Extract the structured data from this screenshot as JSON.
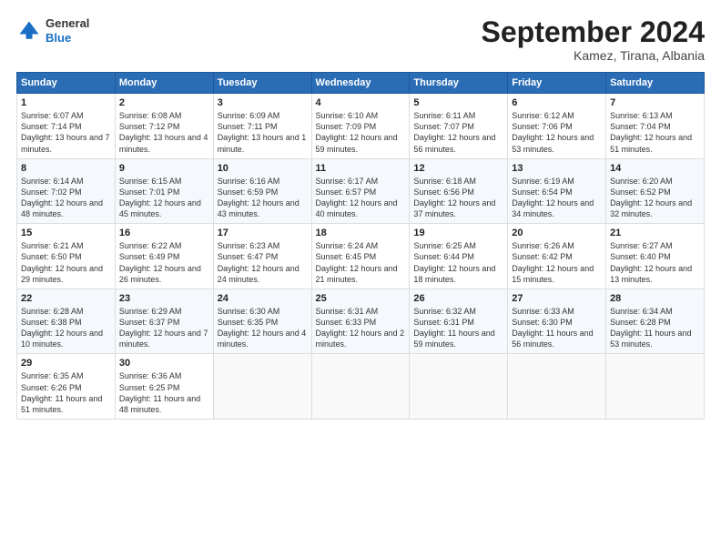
{
  "header": {
    "logo_line1": "General",
    "logo_line2": "Blue",
    "month": "September 2024",
    "location": "Kamez, Tirana, Albania"
  },
  "columns": [
    "Sunday",
    "Monday",
    "Tuesday",
    "Wednesday",
    "Thursday",
    "Friday",
    "Saturday"
  ],
  "weeks": [
    [
      {
        "day": "1",
        "sunrise": "Sunrise: 6:07 AM",
        "sunset": "Sunset: 7:14 PM",
        "daylight": "Daylight: 13 hours and 7 minutes."
      },
      {
        "day": "2",
        "sunrise": "Sunrise: 6:08 AM",
        "sunset": "Sunset: 7:12 PM",
        "daylight": "Daylight: 13 hours and 4 minutes."
      },
      {
        "day": "3",
        "sunrise": "Sunrise: 6:09 AM",
        "sunset": "Sunset: 7:11 PM",
        "daylight": "Daylight: 13 hours and 1 minute."
      },
      {
        "day": "4",
        "sunrise": "Sunrise: 6:10 AM",
        "sunset": "Sunset: 7:09 PM",
        "daylight": "Daylight: 12 hours and 59 minutes."
      },
      {
        "day": "5",
        "sunrise": "Sunrise: 6:11 AM",
        "sunset": "Sunset: 7:07 PM",
        "daylight": "Daylight: 12 hours and 56 minutes."
      },
      {
        "day": "6",
        "sunrise": "Sunrise: 6:12 AM",
        "sunset": "Sunset: 7:06 PM",
        "daylight": "Daylight: 12 hours and 53 minutes."
      },
      {
        "day": "7",
        "sunrise": "Sunrise: 6:13 AM",
        "sunset": "Sunset: 7:04 PM",
        "daylight": "Daylight: 12 hours and 51 minutes."
      }
    ],
    [
      {
        "day": "8",
        "sunrise": "Sunrise: 6:14 AM",
        "sunset": "Sunset: 7:02 PM",
        "daylight": "Daylight: 12 hours and 48 minutes."
      },
      {
        "day": "9",
        "sunrise": "Sunrise: 6:15 AM",
        "sunset": "Sunset: 7:01 PM",
        "daylight": "Daylight: 12 hours and 45 minutes."
      },
      {
        "day": "10",
        "sunrise": "Sunrise: 6:16 AM",
        "sunset": "Sunset: 6:59 PM",
        "daylight": "Daylight: 12 hours and 43 minutes."
      },
      {
        "day": "11",
        "sunrise": "Sunrise: 6:17 AM",
        "sunset": "Sunset: 6:57 PM",
        "daylight": "Daylight: 12 hours and 40 minutes."
      },
      {
        "day": "12",
        "sunrise": "Sunrise: 6:18 AM",
        "sunset": "Sunset: 6:56 PM",
        "daylight": "Daylight: 12 hours and 37 minutes."
      },
      {
        "day": "13",
        "sunrise": "Sunrise: 6:19 AM",
        "sunset": "Sunset: 6:54 PM",
        "daylight": "Daylight: 12 hours and 34 minutes."
      },
      {
        "day": "14",
        "sunrise": "Sunrise: 6:20 AM",
        "sunset": "Sunset: 6:52 PM",
        "daylight": "Daylight: 12 hours and 32 minutes."
      }
    ],
    [
      {
        "day": "15",
        "sunrise": "Sunrise: 6:21 AM",
        "sunset": "Sunset: 6:50 PM",
        "daylight": "Daylight: 12 hours and 29 minutes."
      },
      {
        "day": "16",
        "sunrise": "Sunrise: 6:22 AM",
        "sunset": "Sunset: 6:49 PM",
        "daylight": "Daylight: 12 hours and 26 minutes."
      },
      {
        "day": "17",
        "sunrise": "Sunrise: 6:23 AM",
        "sunset": "Sunset: 6:47 PM",
        "daylight": "Daylight: 12 hours and 24 minutes."
      },
      {
        "day": "18",
        "sunrise": "Sunrise: 6:24 AM",
        "sunset": "Sunset: 6:45 PM",
        "daylight": "Daylight: 12 hours and 21 minutes."
      },
      {
        "day": "19",
        "sunrise": "Sunrise: 6:25 AM",
        "sunset": "Sunset: 6:44 PM",
        "daylight": "Daylight: 12 hours and 18 minutes."
      },
      {
        "day": "20",
        "sunrise": "Sunrise: 6:26 AM",
        "sunset": "Sunset: 6:42 PM",
        "daylight": "Daylight: 12 hours and 15 minutes."
      },
      {
        "day": "21",
        "sunrise": "Sunrise: 6:27 AM",
        "sunset": "Sunset: 6:40 PM",
        "daylight": "Daylight: 12 hours and 13 minutes."
      }
    ],
    [
      {
        "day": "22",
        "sunrise": "Sunrise: 6:28 AM",
        "sunset": "Sunset: 6:38 PM",
        "daylight": "Daylight: 12 hours and 10 minutes."
      },
      {
        "day": "23",
        "sunrise": "Sunrise: 6:29 AM",
        "sunset": "Sunset: 6:37 PM",
        "daylight": "Daylight: 12 hours and 7 minutes."
      },
      {
        "day": "24",
        "sunrise": "Sunrise: 6:30 AM",
        "sunset": "Sunset: 6:35 PM",
        "daylight": "Daylight: 12 hours and 4 minutes."
      },
      {
        "day": "25",
        "sunrise": "Sunrise: 6:31 AM",
        "sunset": "Sunset: 6:33 PM",
        "daylight": "Daylight: 12 hours and 2 minutes."
      },
      {
        "day": "26",
        "sunrise": "Sunrise: 6:32 AM",
        "sunset": "Sunset: 6:31 PM",
        "daylight": "Daylight: 11 hours and 59 minutes."
      },
      {
        "day": "27",
        "sunrise": "Sunrise: 6:33 AM",
        "sunset": "Sunset: 6:30 PM",
        "daylight": "Daylight: 11 hours and 56 minutes."
      },
      {
        "day": "28",
        "sunrise": "Sunrise: 6:34 AM",
        "sunset": "Sunset: 6:28 PM",
        "daylight": "Daylight: 11 hours and 53 minutes."
      }
    ],
    [
      {
        "day": "29",
        "sunrise": "Sunrise: 6:35 AM",
        "sunset": "Sunset: 6:26 PM",
        "daylight": "Daylight: 11 hours and 51 minutes."
      },
      {
        "day": "30",
        "sunrise": "Sunrise: 6:36 AM",
        "sunset": "Sunset: 6:25 PM",
        "daylight": "Daylight: 11 hours and 48 minutes."
      },
      null,
      null,
      null,
      null,
      null
    ]
  ]
}
